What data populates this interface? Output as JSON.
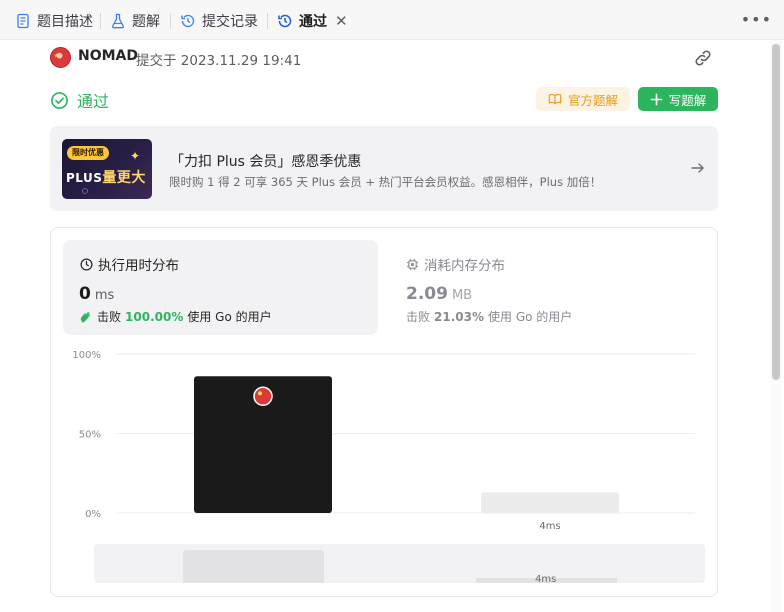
{
  "tabs": [
    {
      "label": "题目描述",
      "icon": "document-icon"
    },
    {
      "label": "题解",
      "icon": "flask-icon"
    },
    {
      "label": "提交记录",
      "icon": "history-icon"
    },
    {
      "label": "通过",
      "icon": "history-icon",
      "active": true
    }
  ],
  "header": {
    "username": "NOMAD",
    "submitted_text": "提交于 2023.11.29 19:41"
  },
  "status": {
    "label": "通过",
    "color": "#2db55d"
  },
  "buttons": {
    "official_solution": "官方题解",
    "write_solution": "写题解"
  },
  "promo": {
    "badge": "限时优惠",
    "image_text_plus": "PLUS",
    "image_text": "量更大",
    "title": "「力扣 Plus 会员」感恩季优惠",
    "subtitle": "限时购 1 得 2 可享 365 天 Plus 会员 + 热门平台会员权益。感恩相伴，Plus 加倍！"
  },
  "runtime": {
    "label": "执行用时分布",
    "value": "0",
    "unit": "ms",
    "beat_prefix": "击败",
    "beat_percent": "100.00%",
    "beat_suffix": "使用 Go 的用户"
  },
  "memory": {
    "label": "消耗内存分布",
    "value": "2.09",
    "unit": "MB",
    "beat_prefix": "击败",
    "beat_percent": "21.03%",
    "beat_suffix": "使用 Go 的用户"
  },
  "chart_data": {
    "type": "bar",
    "categories": [
      "",
      "4ms"
    ],
    "values": [
      86,
      13
    ],
    "ylim": [
      0,
      100
    ],
    "yticks": [
      "100%",
      "50%",
      "0%"
    ],
    "highlight_index": 0,
    "colors": {
      "highlight": "#1a1a1a",
      "other": "#ebebeb"
    },
    "overview_label": "4ms"
  }
}
